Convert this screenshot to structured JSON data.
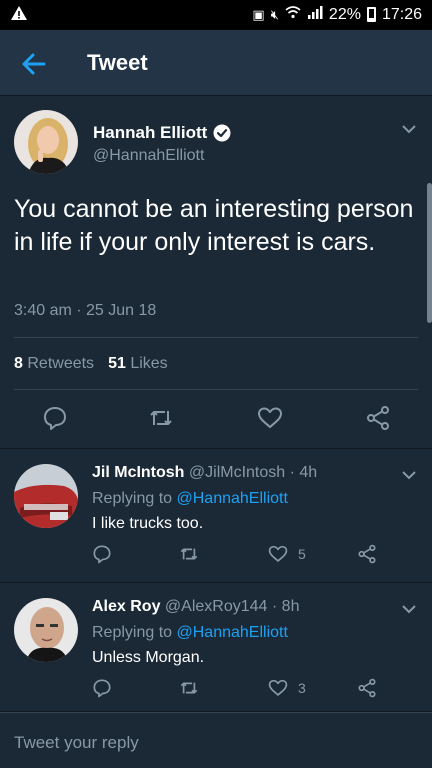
{
  "status_bar": {
    "battery": "22%",
    "time": "17:26"
  },
  "header": {
    "title": "Tweet",
    "back_icon": "arrow-left-icon",
    "accent_color": "#1da1f2"
  },
  "main_tweet": {
    "author_name": "Hannah Elliott",
    "author_handle": "@HannahElliott",
    "verified": true,
    "text": "You cannot be an interesting person in life if your only interest is cars.",
    "timestamp": "3:40 am · 25 Jun 18",
    "retweets_count": "8",
    "retweets_label": "Retweets",
    "likes_count": "51",
    "likes_label": "Likes"
  },
  "replies": [
    {
      "name": "Jil McIntosh",
      "handle": "@JilMcIntosh",
      "time": "· 4h",
      "replying_prefix": "Replying to",
      "replying_to": "@HannahElliott",
      "text": "I like trucks too.",
      "like_count": "5"
    },
    {
      "name": "Alex Roy",
      "handle": "@AlexRoy144",
      "time": "· 8h",
      "replying_prefix": "Replying to",
      "replying_to": "@HannahElliott",
      "text": "Unless Morgan.",
      "like_count": "3"
    }
  ],
  "compose": {
    "placeholder": "Tweet your reply"
  },
  "colors": {
    "background": "#1b2836",
    "header": "#243447",
    "secondary_text": "#8899a6",
    "link": "#1da1f2"
  }
}
